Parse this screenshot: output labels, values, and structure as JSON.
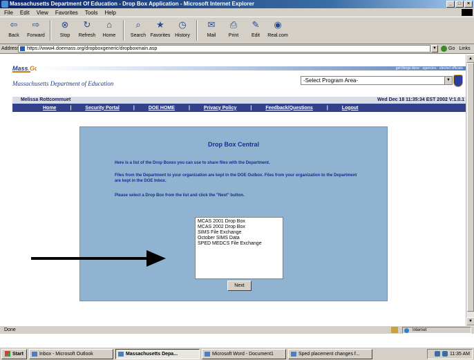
{
  "window": {
    "title": "Massachusetts Department Of Education - Drop Box Application - Microsoft Internet Explorer"
  },
  "menu": [
    "File",
    "Edit",
    "View",
    "Favorites",
    "Tools",
    "Help"
  ],
  "toolbar": [
    {
      "label": "Back",
      "icon": "back-arrow-icon"
    },
    {
      "label": "Forward",
      "icon": "forward-arrow-icon"
    },
    {
      "label": "Stop",
      "icon": "stop-icon"
    },
    {
      "label": "Refresh",
      "icon": "refresh-icon"
    },
    {
      "label": "Home",
      "icon": "home-icon"
    },
    {
      "label": "Search",
      "icon": "search-icon"
    },
    {
      "label": "Favorites",
      "icon": "favorites-icon"
    },
    {
      "label": "History",
      "icon": "history-icon"
    },
    {
      "label": "Mail",
      "icon": "mail-icon"
    },
    {
      "label": "Print",
      "icon": "print-icon"
    },
    {
      "label": "Edit",
      "icon": "edit-icon"
    },
    {
      "label": "Real.com",
      "icon": "real-icon"
    }
  ],
  "address": {
    "label": "Address",
    "url": "https://www4.doemass.org/dropboxgeneric/dropboxmain.asp",
    "go_label": "Go",
    "links_label": "Links"
  },
  "site": {
    "logo_text": "Mass",
    "logo_accent": ".Gov",
    "tagline": "get things done · agencies · elected officials",
    "department": "Massachusetts Department of Education",
    "program_select": "-Select Program Area-",
    "user_name": "Melissa Rottcommuet",
    "datetime": "Wed Dec 18 11:35:34 EST 2002   V:1.0.1"
  },
  "nav": [
    "Home",
    "Security Portal",
    "DOE HOME",
    "Privacy Policy",
    "Feedback/Questions",
    "Logout"
  ],
  "dropbox": {
    "title": "Drop Box Central",
    "intro": "Here is a list of the Drop Boxes you can use to share files with the Department.",
    "files_note": "Files from the Department to your organization are kept in the DOE Outbox. Files from your organization to the Department are kept in the DOE Inbox.",
    "instruction": "Please select a Drop Box from the list and click the \"Next\" button.",
    "options": [
      "MCAS 2001 Drop Box",
      "MCAS 2002 Drop Box",
      "SIMS File Exchange",
      "October SIMS Data",
      "SPED MEDCS File Exchange"
    ],
    "next_label": "Next"
  },
  "status": {
    "text": "Done",
    "zone": "Internet"
  },
  "taskbar": {
    "start_label": "Start",
    "tasks": [
      "Inbox - Microsoft Outlook",
      "Massachusetts Depa...",
      "Microsoft Word - Document1",
      "Sped placement changes f..."
    ],
    "active_index": 1,
    "clock": "11:35 AM"
  }
}
